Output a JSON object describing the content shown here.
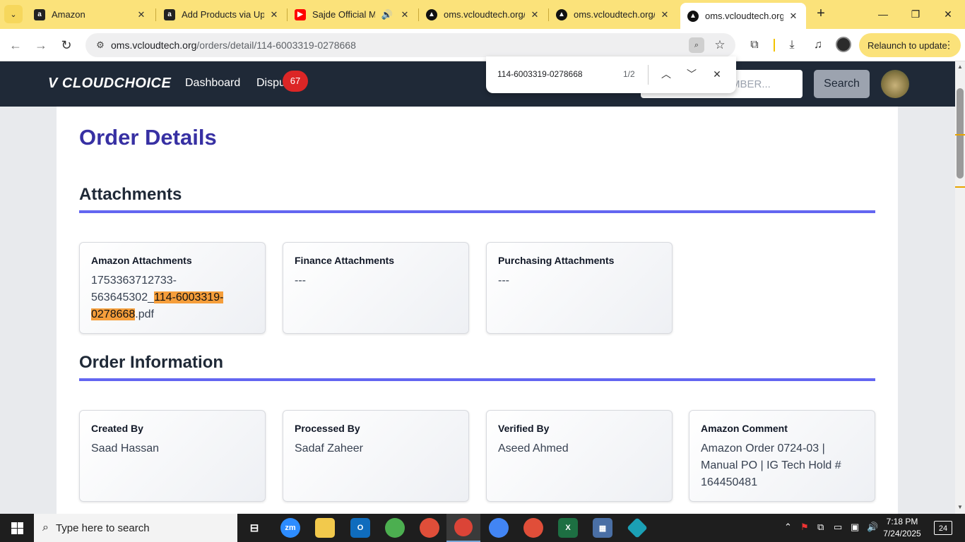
{
  "browser": {
    "tabs": [
      {
        "title": "Amazon",
        "favicon": "amazon-icon"
      },
      {
        "title": "Add Products via Upl",
        "favicon": "amazon-icon"
      },
      {
        "title": "Sajde Official Mu",
        "favicon": "youtube-icon"
      },
      {
        "title": "oms.vcloudtech.org/",
        "favicon": "vercel-icon"
      },
      {
        "title": "oms.vcloudtech.org/",
        "favicon": "vercel-icon"
      },
      {
        "title": "oms.vcloudtech.org/",
        "favicon": "vercel-icon"
      }
    ],
    "url_host": "oms.vcloudtech.org",
    "url_path": "/orders/detail/114-6003319-0278668",
    "relaunch_label": "Relaunch to update"
  },
  "find_bar": {
    "query": "114-6003319-0278668",
    "count": "1/2"
  },
  "header": {
    "logo": "CLOUDCHOICE",
    "nav": [
      {
        "label": "Dashboard"
      },
      {
        "label": "Dispu"
      }
    ],
    "disputes_badge": "67",
    "search_placeholder": "MBER...",
    "search_button": "Search"
  },
  "page": {
    "title": "Order Details",
    "attachments": {
      "heading": "Attachments",
      "cards": [
        {
          "label": "Amazon Attachments",
          "prefix": "1753363712733-563645302_",
          "match": "114-6003319-0278668",
          "suffix": ".pdf"
        },
        {
          "label": "Finance Attachments",
          "value": "---"
        },
        {
          "label": "Purchasing Attachments",
          "value": "---"
        }
      ]
    },
    "order_information": {
      "heading": "Order Information",
      "cards": [
        {
          "label": "Created By",
          "value": "Saad Hassan"
        },
        {
          "label": "Processed By",
          "value": "Sadaf Zaheer"
        },
        {
          "label": "Verified By",
          "value": "Aseed Ahmed"
        },
        {
          "label": "Amazon Comment",
          "value": "Amazon Order 0724-03 | Manual PO | IG Tech Hold # 164450481"
        }
      ]
    }
  },
  "taskbar": {
    "search_placeholder": "Type here to search",
    "time": "7:18 PM",
    "date": "7/24/2025",
    "notifications": "24"
  },
  "colors": {
    "tab_strip": "#fbe27a",
    "header_bg": "#1f2937",
    "title": "#3730a3",
    "rule": "#6366f1",
    "highlight": "#f59e3b",
    "badge": "#dc2626"
  }
}
